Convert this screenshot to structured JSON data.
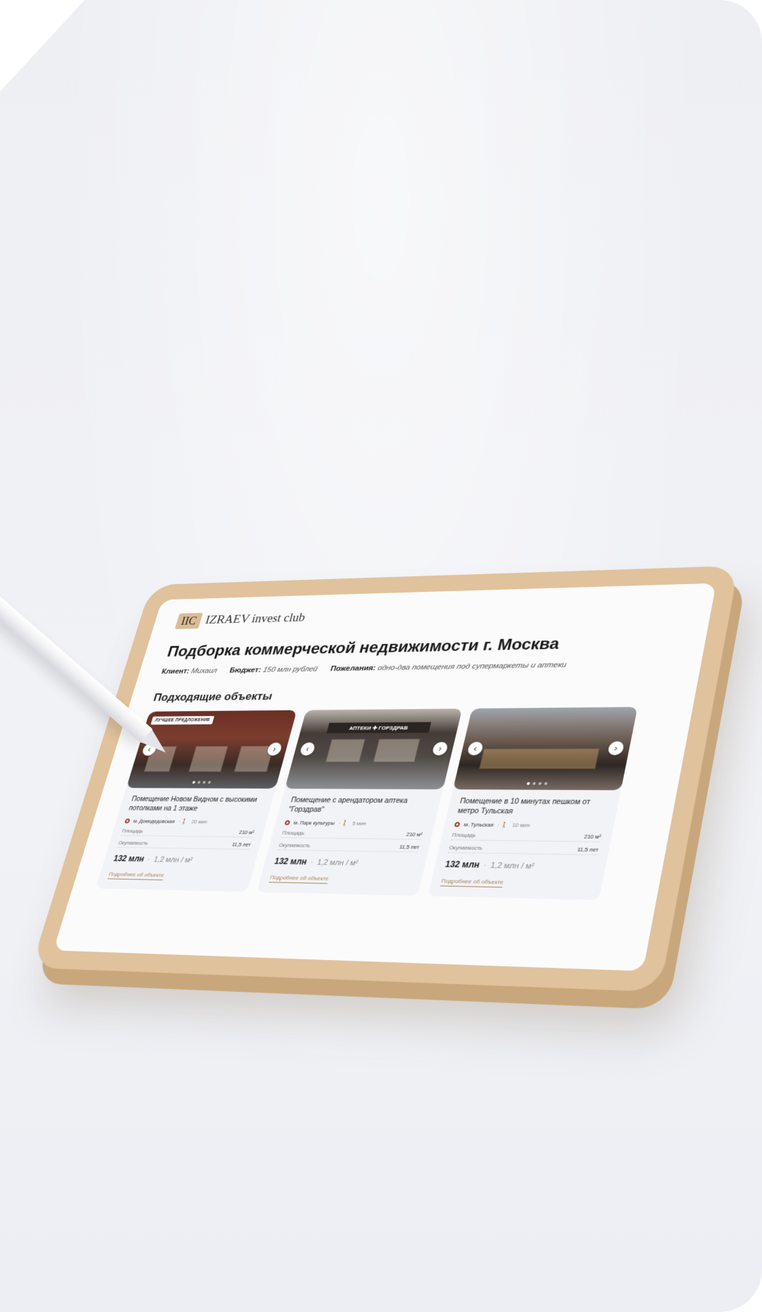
{
  "brand": {
    "logo": "IIC",
    "name": "IZRAEV invest club"
  },
  "page_title": "Подборка коммерческой недвижимости г. Москва",
  "meta": {
    "client_label": "Клиент:",
    "client_value": "Михаил",
    "budget_label": "Бюджет:",
    "budget_value": "150 млн рублей",
    "wishes_label": "Пожелания:",
    "wishes_value": "одно-два помещения под супермаркеты и аптеки"
  },
  "section_title": "Подходящие объекты",
  "cards": [
    {
      "badge": "ЛУЧШЕЕ ПРЕДЛОЖЕНИЕ",
      "title": "Помещение Новом Видном с высокими потолками на 1 этаже",
      "metro": "м. Домодедовская",
      "walk": "20 мин",
      "area_label": "Площадь",
      "area_value": "210 м²",
      "payback_label": "Окупаемость",
      "payback_value": "11,5 лет",
      "price": "132 млн",
      "price_per": "1,2 млн / м²",
      "more": "Подробнее об объекте"
    },
    {
      "sign": "АПТЕКИ ✚ ГОРЗДРАВ",
      "title": "Помещение с арендатором аптека \"Горздрав\"",
      "metro": "м. Парк культуры",
      "walk": "5 мин",
      "area_label": "Площадь",
      "area_value": "210 м²",
      "payback_label": "Окупаемость",
      "payback_value": "11,5 лет",
      "price": "132 млн",
      "price_per": "1,2 млн / м²",
      "more": "Подробнее об объекте"
    },
    {
      "title": "Помещение в 10 минутах пешком от метро Тульская",
      "metro": "м. Тульская",
      "walk": "10 мин",
      "area_label": "Площадь",
      "area_value": "210 м²",
      "payback_label": "Окупаемость",
      "payback_value": "11,5 лет",
      "price": "132 млн",
      "price_per": "1,2 млн / м²",
      "more": "Подробнее об объекте"
    }
  ],
  "icons": {
    "prev": "chevron-left-icon",
    "next": "chevron-right-icon",
    "metro": "metro-icon",
    "walk": "walk-icon"
  },
  "colors": {
    "tablet_frame": "#e0c29c",
    "accent": "#a7865e",
    "metro": "#9d3b2f"
  }
}
